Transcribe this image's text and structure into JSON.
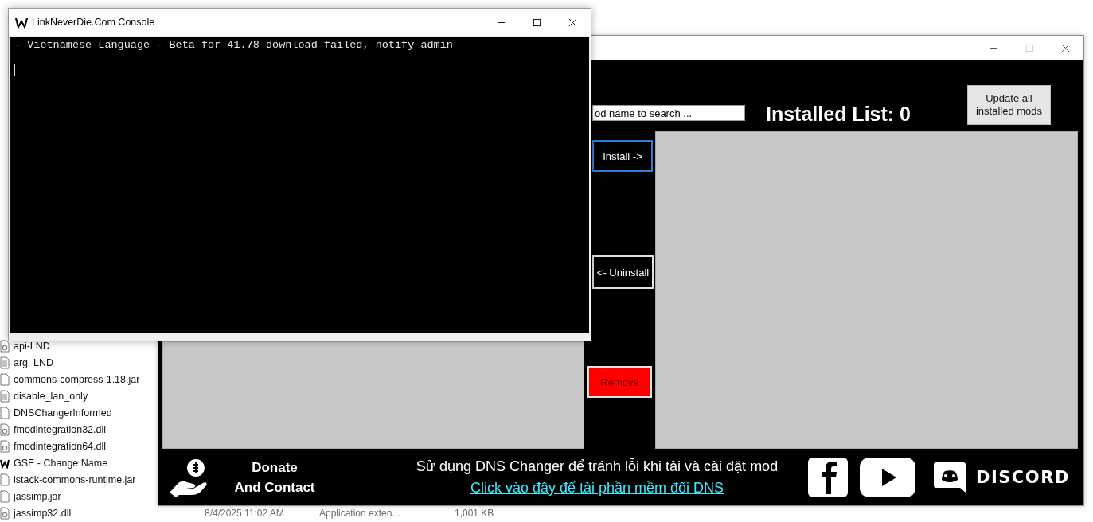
{
  "explorer": {
    "files": [
      {
        "name": "api-LND",
        "kind": "dll"
      },
      {
        "name": "arg_LND",
        "kind": "doc"
      },
      {
        "name": "commons-compress-1.18.jar",
        "kind": "blank"
      },
      {
        "name": "disable_lan_only",
        "kind": "doc"
      },
      {
        "name": "DNSChangerInformed",
        "kind": "blank"
      },
      {
        "name": "fmodintegration32.dll",
        "kind": "dll"
      },
      {
        "name": "fmodintegration64.dll",
        "kind": "dll"
      },
      {
        "name": "GSE - Change Name",
        "kind": "app"
      },
      {
        "name": "istack-commons-runtime.jar",
        "kind": "blank"
      },
      {
        "name": "jassimp.jar",
        "kind": "blank"
      },
      {
        "name": "jassimp32.dll",
        "kind": "dll",
        "date": "8/4/2025 11:02 AM",
        "type": "Application exten...",
        "size": "1,001 KB"
      }
    ]
  },
  "mod_manager": {
    "search": {
      "placeholder": "od name to search ..."
    },
    "installed_title": "Installed List: 0",
    "update_button": "Update all installed mods",
    "buttons": [
      {
        "label": "Install ->",
        "kind": "install",
        "focused": true
      },
      {
        "label": "<- Uninstall",
        "kind": "uninstall",
        "focused": false
      },
      {
        "label": "Remove",
        "kind": "remove",
        "focused": false
      }
    ],
    "footer": {
      "donate_lines": [
        "Donate",
        "And Contact"
      ],
      "notice": "Sử dụng DNS Changer để tránh lỗi khi tải và cài đặt mod",
      "link": "Click vào đây để tải phần mềm đổi DNS",
      "discord": "DISCORD"
    }
  },
  "console": {
    "title": "LinkNeverDie.Com Console",
    "lines": [
      "- Vietnamese Language - Beta for 41.78 download failed, notify admin"
    ]
  }
}
